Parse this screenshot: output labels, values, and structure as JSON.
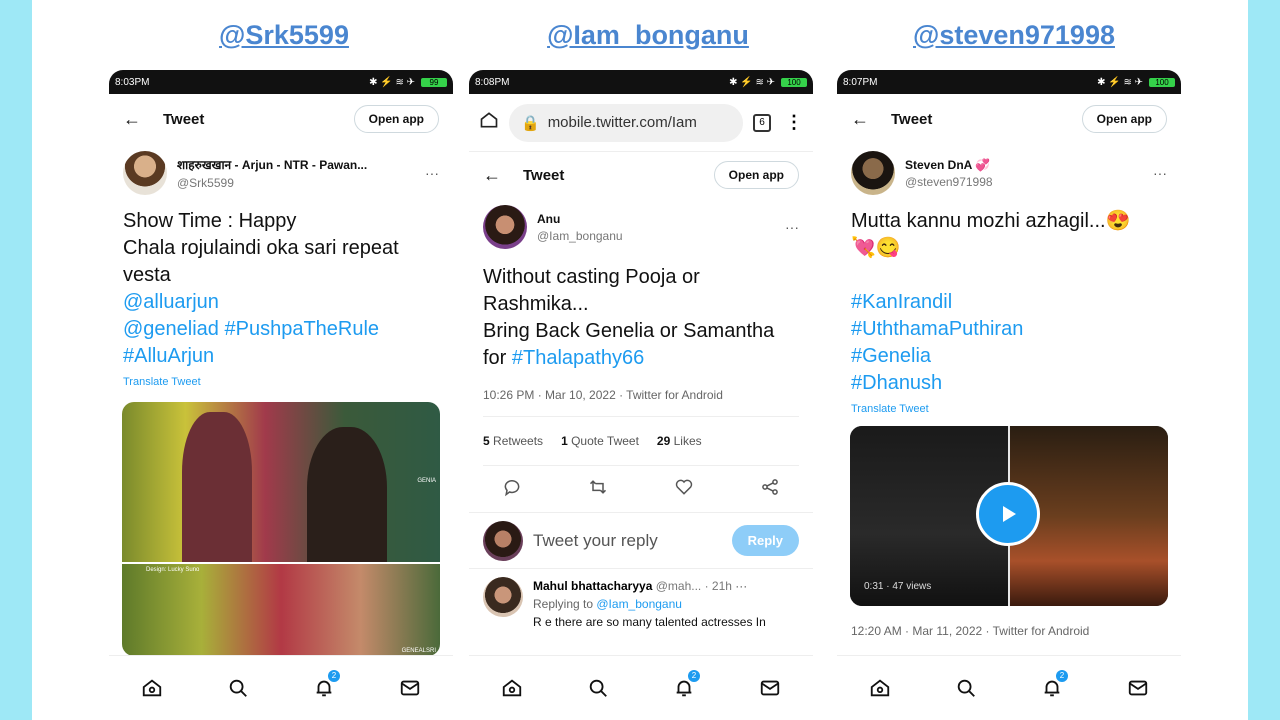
{
  "handles": [
    "@Srk5599",
    "@Iam_bonganu",
    "@steven971998"
  ],
  "phone1": {
    "status_time": "8:03PM",
    "status_battery": "99",
    "back": "←",
    "title": "Tweet",
    "open_app": "Open app",
    "author_name": "शाहरुखखान - Arjun - NTR - Pawan...",
    "author_handle": "@Srk5599",
    "more": "···",
    "lines": [
      "Show Time : Happy",
      "Chala rojulaindi oka sari repeat",
      "vesta"
    ],
    "tags_line1": "@alluarjun",
    "tags_line2a": "@geneliad",
    "tags_line2b": "#PushpaTheRule",
    "tags_line3": "#AlluArjun",
    "translate": "Translate Tweet",
    "media_wm1": "GENIA",
    "media_wm2": "Design: Lucky Suno",
    "media_wm3": "GENEALSRI"
  },
  "phone2": {
    "status_time": "8:08PM",
    "status_battery": "100",
    "url": "mobile.twitter.com/Iam",
    "tab_count": "6",
    "title": "Tweet",
    "open_app": "Open app",
    "author_name": "Anu",
    "author_handle": "@Iam_bonganu",
    "more": "···",
    "lines": [
      "Without casting Pooja or",
      "Rashmika...",
      "Bring Back Genelia or Samantha"
    ],
    "line4_pre": "for ",
    "line4_tag": "#Thalapathy66",
    "meta": "10:26 PM · Mar 10, 2022 · Twitter for Android",
    "retweets_n": "5",
    "retweets_l": "Retweets",
    "quote_n": "1",
    "quote_l": "Quote Tweet",
    "likes_n": "29",
    "likes_l": "Likes",
    "reply_placeholder": "Tweet your reply",
    "reply_btn": "Reply",
    "reply_author": "Mahul bhattacharyya",
    "reply_handle": "@mah... · 21h",
    "replying_to_pre": "Replying to ",
    "replying_to_handle": "@Iam_bonganu",
    "reply_text": "R e there are so many talented actresses In"
  },
  "phone3": {
    "status_time": "8:07PM",
    "status_battery": "100",
    "title": "Tweet",
    "open_app": "Open app",
    "author_name": "Steven DnA 💞",
    "author_handle": "@steven971998",
    "more": "···",
    "line1": "Mutta kannu mozhi azhagil...😍",
    "line2": "💘😋",
    "tags": [
      "#KanIrandil",
      "#UththamaPuthiran",
      "#Genelia",
      "#Dhanush"
    ],
    "translate": "Translate Tweet",
    "video_info": "0:31 · 47 views",
    "meta": "12:20 AM · Mar 11, 2022 · Twitter for Android"
  },
  "nav_badge": "2",
  "colors": {
    "accent": "#1d9bf0",
    "handle_title": "#4a86d0",
    "background": "#9ee8f6"
  },
  "icons": [
    "home-icon",
    "search-icon",
    "bell-icon",
    "mail-icon",
    "comment-icon",
    "retweet-icon",
    "heart-icon",
    "share-icon",
    "play-icon",
    "lock-icon"
  ]
}
